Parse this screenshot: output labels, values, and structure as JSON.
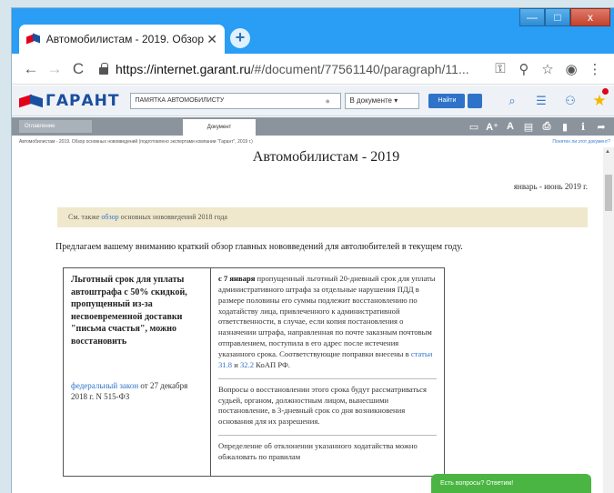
{
  "browser": {
    "tab_title": "Автомобилистам - 2019. Обзор",
    "tab_close": "✕",
    "new_tab": "+",
    "window_controls": {
      "minimize": "—",
      "maximize": "□",
      "close": "x"
    },
    "url_host": "https://internet.garant.ru",
    "url_path": "/#/document/77561140/paragraph/11..."
  },
  "garant": {
    "logo_text": "ГАРАНТ",
    "search_value": "ПАМЯТКА АВТОМОБИЛИСТУ",
    "scope_select": "В документе",
    "find_button": "Найти"
  },
  "subbar": {
    "toc_tab": "Оглавление",
    "doc_tab": "Документ",
    "font_large": "A⁺",
    "font_small": "A"
  },
  "breadcrumb": {
    "path": "Автомобилистам - 2019. Обзор основных нововведений (подготовлено экспертами компании \"Гарант\", 2019 г.)",
    "ask": "Понятен ли этот документ?"
  },
  "document": {
    "title": "Автомобилистам - 2019",
    "date": "январь - июнь 2019 г.",
    "see_also_prefix": "См. также",
    "see_also_link": "обзор",
    "see_also_suffix": "основных нововведений 2018 года",
    "intro": "Предлагаем вашему вниманию краткий обзор главных нововведений для автолюбителей в текущем году.",
    "table": {
      "heading": "Льготный срок для уплаты автоштрафа с 50% скидкой, пропущенный из-за несвоевременной доставки \"письма счастья\", можно восстановить",
      "law_link": "федеральный закон",
      "law_rest": "от 27 декабря 2018 г. N 515-ФЗ",
      "p1_bold": "с 7 января",
      "p1_text": "пропущенный льготный 20-дневный срок для уплаты административного штрафа за отдельные нарушения ПДД в размере половины его суммы подлежит восстановлению по ходатайству лица, привлеченного к административной ответственности, в случае, если копия постановления о назначении штрафа, направленная по почте заказным почтовым отправлением, поступила в его адрес после истечения указанного срока. Соответствующие поправки внесены в",
      "p1_link1": "статьи 31.8",
      "p1_and": "и",
      "p1_link2": "32.2",
      "p1_end": "КоАП РФ.",
      "p2": "Вопросы о восстановлении этого срока будут рассматриваться судьей, органом, должностным лицом, вынесшими постановление, в 3-дневный срок со дня возникновения основания для их разрешения.",
      "p3": "Определение об отклонении указанного ходатайства можно обжаловать по правилам"
    }
  },
  "chat": {
    "label": "Есть вопросы? Ответим!"
  }
}
